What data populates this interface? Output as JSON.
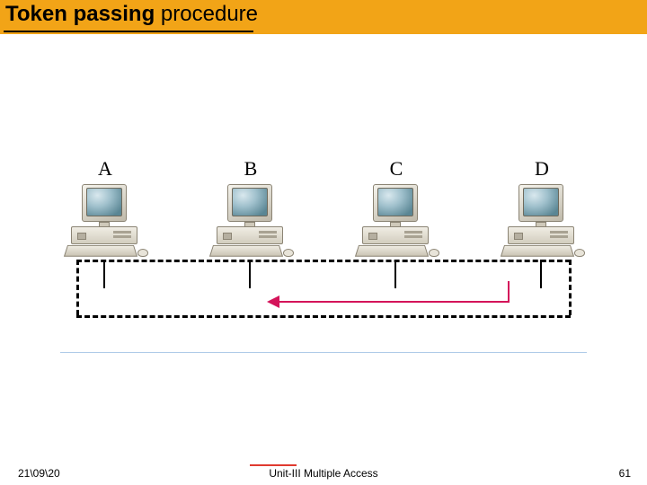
{
  "title": {
    "bold_part": "Token passing",
    "regular_part": " procedure"
  },
  "diagram": {
    "stations": [
      {
        "label": "A"
      },
      {
        "label": "B"
      },
      {
        "label": "C"
      },
      {
        "label": "D"
      }
    ]
  },
  "footer": {
    "date": "21\\09\\20",
    "center": "Unit-III Multiple Access",
    "page": "61"
  }
}
